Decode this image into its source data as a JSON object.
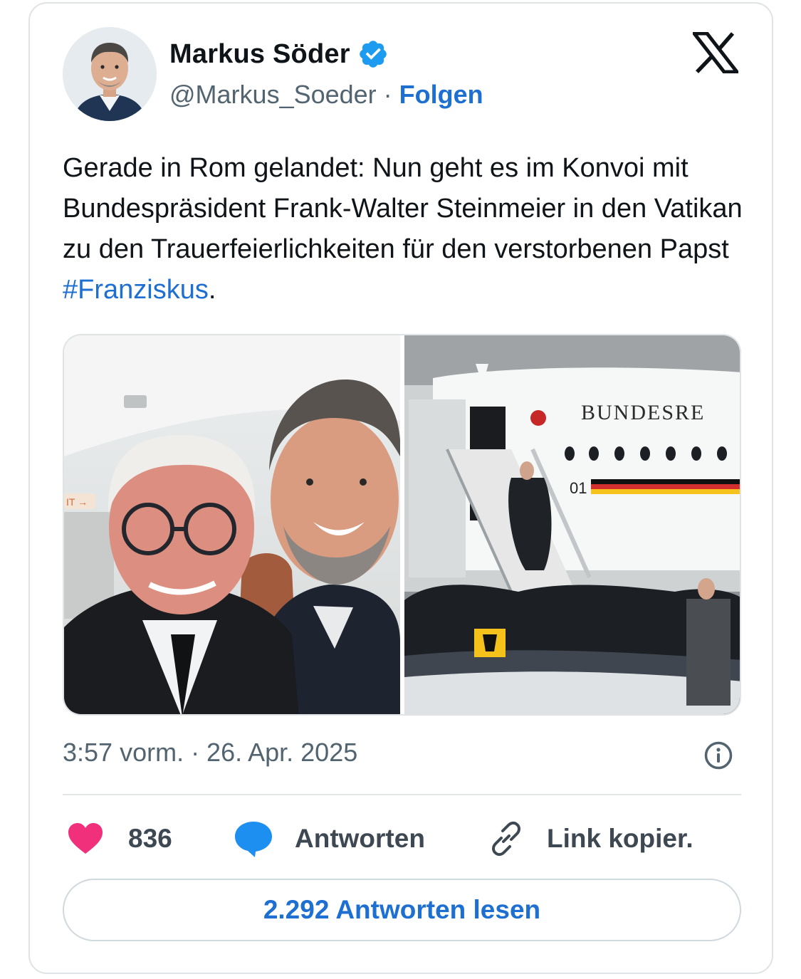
{
  "tweet": {
    "author_name": "Markus Söder",
    "handle": "@Markus_Soeder",
    "separator": " · ",
    "follow_label": "Folgen",
    "text_main": "Gerade in Rom gelandet: Nun geht es im Konvoi mit Bundespräsident Frank-Walter Steinmeier in den Vatikan zu den Trauerfeierlichkeiten für den verstorbenen Papst ",
    "hashtag": "#Franziskus",
    "text_end": ".",
    "timestamp": "3:57 vorm. · 26. Apr. 2025",
    "image_right_text": "BUNDESRE",
    "plane_number": "01"
  },
  "actions": {
    "likes": "836",
    "reply_label": "Antworten",
    "copy_label": "Link kopier."
  },
  "read_replies": "2.292 Antworten lesen",
  "icons": {
    "verified": "verified-badge-icon",
    "logo": "x-logo-icon",
    "info": "info-icon",
    "like": "heart-icon",
    "reply": "speech-bubble-icon",
    "link": "link-icon"
  },
  "colors": {
    "link_blue": "#1d6fd1",
    "verified_blue": "#1d9bf0",
    "heart": "#f0307a",
    "secondary_text": "#536471"
  }
}
